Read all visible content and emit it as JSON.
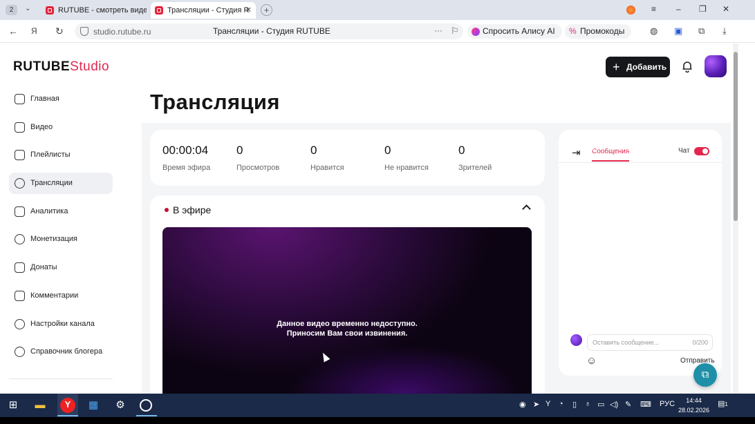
{
  "browser": {
    "tab_count": "2",
    "tabs": [
      {
        "label": "RUTUBE - смотреть виде"
      },
      {
        "label": "Трансляции - Студия R"
      }
    ],
    "address": {
      "host": "studio.rutube.ru",
      "title": "Трансляции - Студия RUTUBE"
    },
    "alice_label": "Спросить Алису AI",
    "promo_label": "Промокоды"
  },
  "header": {
    "logo_main": "RUTUBE",
    "logo_suffix": "Studio",
    "add_label": "Добавить"
  },
  "sidebar": {
    "items": [
      {
        "label": "Главная"
      },
      {
        "label": "Видео"
      },
      {
        "label": "Плейлисты"
      },
      {
        "label": "Трансляции"
      },
      {
        "label": "Аналитика"
      },
      {
        "label": "Монетизация"
      },
      {
        "label": "Донаты"
      },
      {
        "label": "Комментарии"
      },
      {
        "label": "Настройки канала"
      },
      {
        "label": "Справочник блогера"
      }
    ],
    "active_index": 3
  },
  "main": {
    "title": "Трансляция",
    "stats": [
      {
        "value": "00:00:04",
        "label": "Время эфира"
      },
      {
        "value": "0",
        "label": "Просмотров"
      },
      {
        "value": "0",
        "label": "Нравится"
      },
      {
        "value": "0",
        "label": "Не нравится"
      },
      {
        "value": "0",
        "label": "Зрителей"
      }
    ],
    "live_header": "В эфире",
    "player_message_1": "Данное видео временно недоступно.",
    "player_message_2": "Приносим Вам свои извинения."
  },
  "chat": {
    "tab_label": "Сообщения",
    "toggle_label": "Чат",
    "toggle_on": true,
    "input_placeholder": "Оставить сообщение...",
    "counter": "0/200",
    "send_label": "Отправить"
  },
  "taskbar": {
    "lang": "РУС",
    "time": "14:44",
    "date": "28.02.2026",
    "notifications": "1"
  },
  "colors": {
    "accent": "#e2264d",
    "dark_button": "#16171b",
    "taskbar": "#1a2a48"
  }
}
